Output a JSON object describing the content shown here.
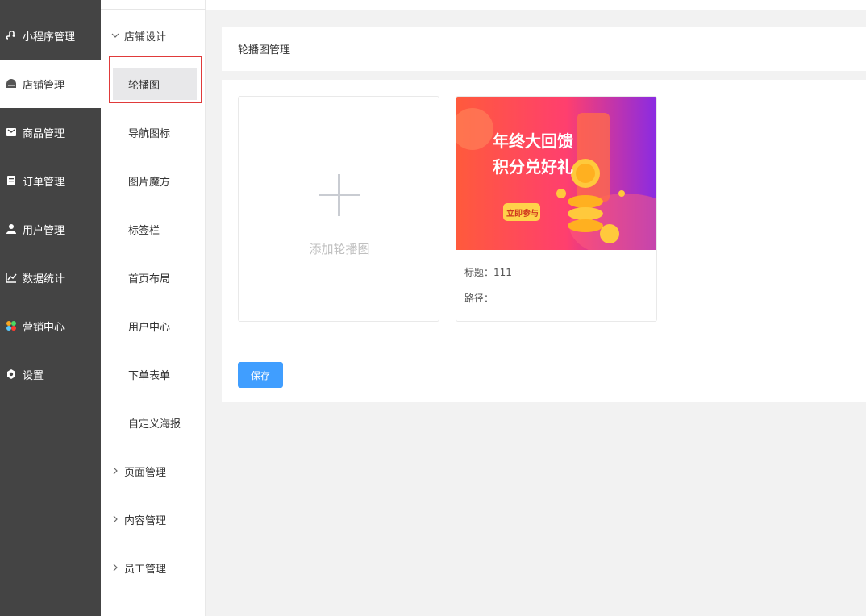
{
  "sidebar": {
    "items": [
      {
        "label": "小程序管理",
        "icon": "miniprogram-icon"
      },
      {
        "label": "店铺管理",
        "icon": "store-icon"
      },
      {
        "label": "商品管理",
        "icon": "goods-icon"
      },
      {
        "label": "订单管理",
        "icon": "order-icon"
      },
      {
        "label": "用户管理",
        "icon": "user-icon"
      },
      {
        "label": "数据统计",
        "icon": "chart-icon"
      },
      {
        "label": "营销中心",
        "icon": "marketing-icon"
      },
      {
        "label": "设置",
        "icon": "settings-icon"
      }
    ]
  },
  "submenu": {
    "group_store_design": "店铺设计",
    "items": [
      "轮播图",
      "导航图标",
      "图片魔方",
      "标签栏",
      "首页布局",
      "用户中心",
      "下单表单",
      "自定义海报"
    ],
    "group_page": "页面管理",
    "group_content": "内容管理",
    "group_staff": "员工管理"
  },
  "main": {
    "panel_title": "轮播图管理",
    "add_label": "添加轮播图",
    "banner": {
      "line1": "年终大回馈",
      "line2": "积分兑好礼",
      "cta": "立即参与",
      "title_line": "标题：111",
      "path_line": "路径："
    },
    "save_label": "保存"
  },
  "colors": {
    "sidebar_bg": "#444444",
    "primary": "#409eff",
    "highlight_border": "#e03a3a"
  }
}
